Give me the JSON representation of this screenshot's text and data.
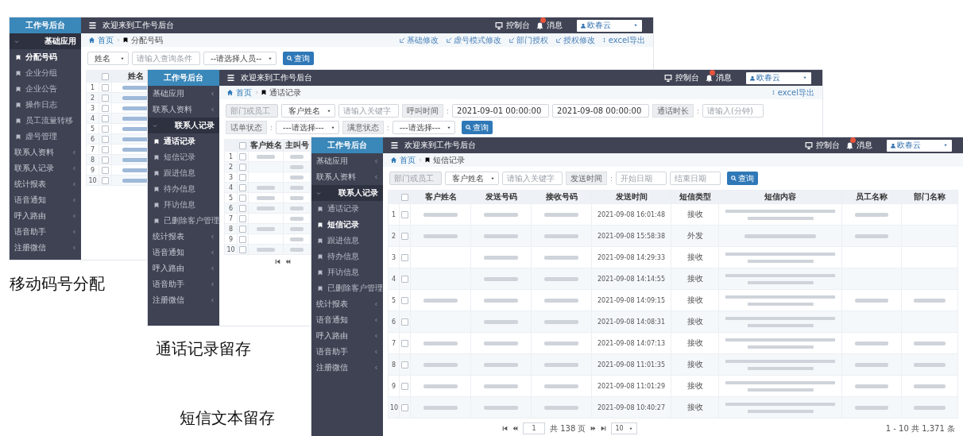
{
  "windows": [
    {
      "sidebar": {
        "title": "工作号后台",
        "items": [
          {
            "label": "基础应用",
            "expanded": true,
            "children": [
              {
                "label": "分配号码",
                "selected": true
              },
              {
                "label": "企业分组",
                "selected": false
              },
              {
                "label": "企业公告",
                "selected": false
              },
              {
                "label": "操作日志",
                "selected": false
              },
              {
                "label": "员工流量转移",
                "selected": false
              },
              {
                "label": "虚号管理",
                "selected": false
              }
            ]
          },
          {
            "label": "联系人资料",
            "expanded": false
          },
          {
            "label": "联系人记录",
            "expanded": false
          },
          {
            "label": "统计报表",
            "expanded": false
          },
          {
            "label": "语音通知",
            "expanded": false
          },
          {
            "label": "呼入路由",
            "expanded": false
          },
          {
            "label": "语音助手",
            "expanded": false
          },
          {
            "label": "注册微信",
            "expanded": false
          }
        ]
      },
      "header": {
        "welcome": "欢迎来到工作号后台",
        "console": "控制台",
        "messages": "消息",
        "user": "欧春云"
      },
      "breadcrumb": {
        "home": "首页",
        "current": "分配号码"
      },
      "actions": [
        {
          "kind": "edit",
          "label": "基础修改"
        },
        {
          "kind": "edit",
          "label": "虚号模式修改"
        },
        {
          "kind": "edit",
          "label": "部门授权"
        },
        {
          "kind": "edit",
          "label": "授权修改"
        },
        {
          "kind": "export",
          "label": "excel导出"
        }
      ],
      "filter_rows": [
        [
          {
            "kind": "select",
            "value": "姓名"
          },
          {
            "kind": "input",
            "placeholder": "请输入查询条件"
          },
          {
            "kind": "select",
            "value": "--请选择人员--"
          },
          {
            "kind": "button",
            "label": "查询"
          }
        ]
      ],
      "table": {
        "header_checked": false,
        "columns": [
          "姓名"
        ],
        "rows": [
          {
            "no": "1",
            "checked": false,
            "cells": [
              {
                "kind": "blurred_link"
              }
            ]
          },
          {
            "no": "2",
            "checked": false,
            "cells": [
              {
                "kind": "blurred_link"
              }
            ]
          },
          {
            "no": "3",
            "checked": false,
            "cells": [
              {
                "kind": "blurred_link"
              }
            ]
          },
          {
            "no": "4",
            "checked": false,
            "cells": [
              {
                "kind": "blurred_link"
              }
            ]
          },
          {
            "no": "5",
            "checked": false,
            "cells": [
              {
                "kind": "blurred_link"
              }
            ]
          },
          {
            "no": "6",
            "checked": false,
            "cells": [
              {
                "kind": "blurred_link"
              }
            ]
          },
          {
            "no": "7",
            "checked": false,
            "cells": [
              {
                "kind": "blurred_link"
              }
            ]
          },
          {
            "no": "8",
            "checked": false,
            "cells": [
              {
                "kind": "blurred_link"
              }
            ]
          },
          {
            "no": "9",
            "checked": false,
            "cells": [
              {
                "kind": "blurred_link"
              }
            ]
          },
          {
            "no": "10",
            "checked": false,
            "cells": [
              {
                "kind": "blurred_link"
              }
            ]
          }
        ]
      }
    },
    {
      "sidebar": {
        "title": "工作号后台",
        "items": [
          {
            "label": "基础应用",
            "expanded": false
          },
          {
            "label": "联系人资料",
            "expanded": false
          },
          {
            "label": "联系人记录",
            "expanded": true,
            "children": [
              {
                "label": "通话记录",
                "selected": true
              },
              {
                "label": "短信记录",
                "selected": false
              },
              {
                "label": "跟进信息",
                "selected": false
              },
              {
                "label": "待办信息",
                "selected": false
              },
              {
                "label": "拜访信息",
                "selected": false
              },
              {
                "label": "已删除客户管理",
                "selected": false
              }
            ]
          },
          {
            "label": "统计报表",
            "expanded": false
          },
          {
            "label": "语音通知",
            "expanded": false
          },
          {
            "label": "呼入路由",
            "expanded": false
          },
          {
            "label": "语音助手",
            "expanded": false
          },
          {
            "label": "注册微信",
            "expanded": false
          }
        ]
      },
      "header": {
        "welcome": "欢迎来到工作号后台",
        "console": "控制台",
        "messages": "消息",
        "user": "欧春云"
      },
      "breadcrumb": {
        "home": "首页",
        "current": "通话记录"
      },
      "actions": [
        {
          "kind": "export",
          "label": "excel导出"
        }
      ],
      "filter_rows": [
        [
          {
            "kind": "input",
            "placeholder": "部门或员工",
            "disabled": true
          },
          {
            "kind": "select",
            "value": "客户姓名"
          },
          {
            "kind": "input",
            "placeholder": "请输入关键字"
          },
          {
            "kind": "label",
            "label": "呼叫时间",
            "sep": ":"
          },
          {
            "kind": "input",
            "value": "2021-09-01 00:00:00"
          },
          {
            "kind": "input",
            "value": "2021-09-08 00:00:00"
          },
          {
            "kind": "label",
            "label": "通话时长",
            "sep": ":"
          },
          {
            "kind": "input",
            "placeholder": "请输入(分钟)"
          }
        ],
        [
          {
            "kind": "label",
            "label": "话单状态",
            "sep": ":"
          },
          {
            "kind": "select",
            "value": "---请选择---"
          },
          {
            "kind": "label",
            "label": "满意状态",
            "sep": ":"
          },
          {
            "kind": "select",
            "value": "---请选择---"
          },
          {
            "kind": "button",
            "label": "查询"
          }
        ]
      ],
      "table": {
        "header_checked": false,
        "columns": [
          "客户姓名",
          "主叫号"
        ],
        "rows": [
          {
            "no": "1",
            "checked": false,
            "cells": [
              {
                "kind": "blurred"
              },
              {
                "kind": "blurred"
              }
            ]
          },
          {
            "no": "2",
            "checked": false,
            "cells": [
              {
                "kind": "empty"
              },
              {
                "kind": "blurred"
              }
            ]
          },
          {
            "no": "3",
            "checked": false,
            "cells": [
              {
                "kind": "empty"
              },
              {
                "kind": "blurred"
              }
            ]
          },
          {
            "no": "4",
            "checked": false,
            "cells": [
              {
                "kind": "blurred"
              },
              {
                "kind": "blurred"
              }
            ]
          },
          {
            "no": "5",
            "checked": false,
            "cells": [
              {
                "kind": "blurred"
              },
              {
                "kind": "blurred"
              }
            ]
          },
          {
            "no": "6",
            "checked": false,
            "cells": [
              {
                "kind": "blurred"
              },
              {
                "kind": "blurred"
              }
            ]
          },
          {
            "no": "7",
            "checked": false,
            "cells": [
              {
                "kind": "empty"
              },
              {
                "kind": "blurred"
              }
            ]
          },
          {
            "no": "8",
            "checked": false,
            "cells": [
              {
                "kind": "blurred"
              },
              {
                "kind": "blurred"
              }
            ]
          },
          {
            "no": "9",
            "checked": false,
            "cells": [
              {
                "kind": "empty"
              },
              {
                "kind": "blurred"
              }
            ]
          },
          {
            "no": "10",
            "checked": false,
            "cells": [
              {
                "kind": "blurred"
              },
              {
                "kind": "blurred"
              }
            ]
          }
        ]
      }
    },
    {
      "sidebar": {
        "title": "工作号后台",
        "items": [
          {
            "label": "基础应用",
            "expanded": false
          },
          {
            "label": "联系人资料",
            "expanded": false
          },
          {
            "label": "联系人记录",
            "expanded": true,
            "children": [
              {
                "label": "通话记录",
                "selected": false
              },
              {
                "label": "短信记录",
                "selected": true
              },
              {
                "label": "跟进信息",
                "selected": false
              },
              {
                "label": "待办信息",
                "selected": false
              },
              {
                "label": "拜访信息",
                "selected": false
              },
              {
                "label": "已删除客户管理",
                "selected": false
              }
            ]
          },
          {
            "label": "统计报表",
            "expanded": false
          },
          {
            "label": "语音通知",
            "expanded": false
          },
          {
            "label": "呼入路由",
            "expanded": false
          },
          {
            "label": "语音助手",
            "expanded": false
          },
          {
            "label": "注册微信",
            "expanded": false
          }
        ]
      },
      "header": {
        "welcome": "欢迎来到工作号后台",
        "console": "控制台",
        "messages": "消息",
        "user": "欧春云"
      },
      "breadcrumb": {
        "home": "首页",
        "current": "短信记录"
      },
      "filter_rows": [
        [
          {
            "kind": "input",
            "placeholder": "部门或员工",
            "disabled": true
          },
          {
            "kind": "select",
            "value": "客户姓名"
          },
          {
            "kind": "input",
            "placeholder": "请输入关键字"
          },
          {
            "kind": "label",
            "label": "发送时间",
            "sep": ":"
          },
          {
            "kind": "input",
            "placeholder": "开始日期"
          },
          {
            "kind": "input",
            "placeholder": "结束日期"
          },
          {
            "kind": "button",
            "label": "查询"
          }
        ]
      ],
      "table": {
        "header_checked": false,
        "columns": [
          "客户姓名",
          "发送号码",
          "接收号码",
          "发送时间",
          "短信类型",
          "短信内容",
          "员工名称",
          "部门名称"
        ],
        "rows": [
          {
            "no": "1",
            "checked": false,
            "cells": [
              {
                "kind": "blurred"
              },
              {
                "kind": "blurred"
              },
              {
                "kind": "blurred"
              },
              {
                "kind": "text",
                "text": "2021-09-08 16:01:48"
              },
              {
                "kind": "text",
                "text": "接收"
              },
              {
                "kind": "paragraph"
              },
              {
                "kind": "blurred"
              },
              {
                "kind": "empty"
              }
            ]
          },
          {
            "no": "2",
            "checked": false,
            "cells": [
              {
                "kind": "blurred"
              },
              {
                "kind": "blurred"
              },
              {
                "kind": "blurred"
              },
              {
                "kind": "text",
                "text": "2021-09-08 15:58:38"
              },
              {
                "kind": "text",
                "text": "外发"
              },
              {
                "kind": "blurred"
              },
              {
                "kind": "blurred"
              },
              {
                "kind": "empty"
              }
            ]
          },
          {
            "no": "3",
            "checked": false,
            "cells": [
              {
                "kind": "empty"
              },
              {
                "kind": "blurred"
              },
              {
                "kind": "blurred"
              },
              {
                "kind": "text",
                "text": "2021-09-08 14:29:33"
              },
              {
                "kind": "text",
                "text": "接收"
              },
              {
                "kind": "paragraph"
              },
              {
                "kind": "empty"
              },
              {
                "kind": "empty"
              }
            ]
          },
          {
            "no": "4",
            "checked": false,
            "cells": [
              {
                "kind": "empty"
              },
              {
                "kind": "blurred"
              },
              {
                "kind": "blurred"
              },
              {
                "kind": "text",
                "text": "2021-09-08 14:14:55"
              },
              {
                "kind": "text",
                "text": "接收"
              },
              {
                "kind": "paragraph"
              },
              {
                "kind": "empty"
              },
              {
                "kind": "empty"
              }
            ]
          },
          {
            "no": "5",
            "checked": false,
            "cells": [
              {
                "kind": "blurred"
              },
              {
                "kind": "blurred"
              },
              {
                "kind": "blurred"
              },
              {
                "kind": "text",
                "text": "2021-09-08 14:09:15"
              },
              {
                "kind": "text",
                "text": "接收"
              },
              {
                "kind": "paragraph"
              },
              {
                "kind": "blurred"
              },
              {
                "kind": "blurred"
              }
            ]
          },
          {
            "no": "6",
            "checked": false,
            "cells": [
              {
                "kind": "empty"
              },
              {
                "kind": "blurred"
              },
              {
                "kind": "blurred"
              },
              {
                "kind": "text",
                "text": "2021-09-08 14:08:31"
              },
              {
                "kind": "text",
                "text": "接收"
              },
              {
                "kind": "paragraph"
              },
              {
                "kind": "empty"
              },
              {
                "kind": "empty"
              }
            ]
          },
          {
            "no": "7",
            "checked": false,
            "cells": [
              {
                "kind": "blurred"
              },
              {
                "kind": "blurred"
              },
              {
                "kind": "blurred"
              },
              {
                "kind": "text",
                "text": "2021-09-08 14:07:13"
              },
              {
                "kind": "text",
                "text": "接收"
              },
              {
                "kind": "paragraph"
              },
              {
                "kind": "blurred"
              },
              {
                "kind": "blurred"
              }
            ]
          },
          {
            "no": "8",
            "checked": false,
            "cells": [
              {
                "kind": "blurred"
              },
              {
                "kind": "blurred"
              },
              {
                "kind": "blurred"
              },
              {
                "kind": "text",
                "text": "2021-09-08 11:01:35"
              },
              {
                "kind": "text",
                "text": "接收"
              },
              {
                "kind": "paragraph"
              },
              {
                "kind": "blurred"
              },
              {
                "kind": "blurred"
              }
            ]
          },
          {
            "no": "9",
            "checked": false,
            "cells": [
              {
                "kind": "blurred"
              },
              {
                "kind": "blurred"
              },
              {
                "kind": "blurred"
              },
              {
                "kind": "text",
                "text": "2021-09-08 11:01:29"
              },
              {
                "kind": "text",
                "text": "接收"
              },
              {
                "kind": "paragraph"
              },
              {
                "kind": "blurred"
              },
              {
                "kind": "blurred"
              }
            ]
          },
          {
            "no": "10",
            "checked": false,
            "cells": [
              {
                "kind": "blurred"
              },
              {
                "kind": "blurred"
              },
              {
                "kind": "blurred"
              },
              {
                "kind": "text",
                "text": "2021-09-08 10:40:27"
              },
              {
                "kind": "text",
                "text": "接收"
              },
              {
                "kind": "paragraph"
              },
              {
                "kind": "blurred"
              },
              {
                "kind": "blurred"
              }
            ]
          }
        ]
      },
      "pagination": {
        "page": "1",
        "pages": "共 138 页",
        "page_size": "10",
        "summary": "1 - 10  共 1,371 条"
      }
    }
  ],
  "captions": [
    "移动码号分配",
    "通话记录留存",
    "短信文本留存"
  ]
}
